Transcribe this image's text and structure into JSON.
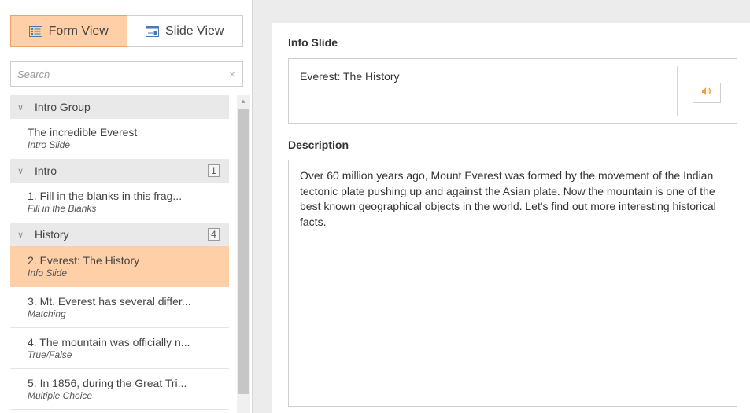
{
  "view_toggle": {
    "form_view_label": "Form View",
    "slide_view_label": "Slide View"
  },
  "search": {
    "placeholder": "Search",
    "clear_symbol": "×"
  },
  "tree": {
    "groups": [
      {
        "label": "Intro Group",
        "count": ""
      },
      {
        "label": "Intro",
        "count": "1"
      },
      {
        "label": "History",
        "count": "4"
      }
    ],
    "items": [
      {
        "title": "The incredible Everest",
        "subtitle": "Intro Slide"
      },
      {
        "title": "1. Fill in the blanks in this frag...",
        "subtitle": "Fill in the Blanks"
      },
      {
        "title": "2. Everest: The History",
        "subtitle": "Info Slide",
        "selected": true
      },
      {
        "title": "3. Mt. Everest has several differ...",
        "subtitle": "Matching"
      },
      {
        "title": "4. The mountain was officially n...",
        "subtitle": "True/False"
      },
      {
        "title": "5. In 1856, during the Great Tri...",
        "subtitle": "Multiple Choice"
      }
    ]
  },
  "editor": {
    "title_label": "Info Slide",
    "title_value": "Everest: The History",
    "description_label": "Description",
    "description_value": "Over 60 million years ago, Mount Everest was formed by the movement of the Indian tectonic plate pushing up and against the Asian plate. Now the mountain is one of the best known geographical objects in the world. Let's find out more interesting historical facts."
  },
  "icons": {
    "form_view": "list-form-icon",
    "slide_view": "slide-icon",
    "audio": "speaker-icon",
    "collapse": "chevron-down-icon"
  },
  "colors": {
    "accent": "#ffcfa7",
    "accent_border": "#f0a06a",
    "audio_icon": "#f0a030"
  }
}
